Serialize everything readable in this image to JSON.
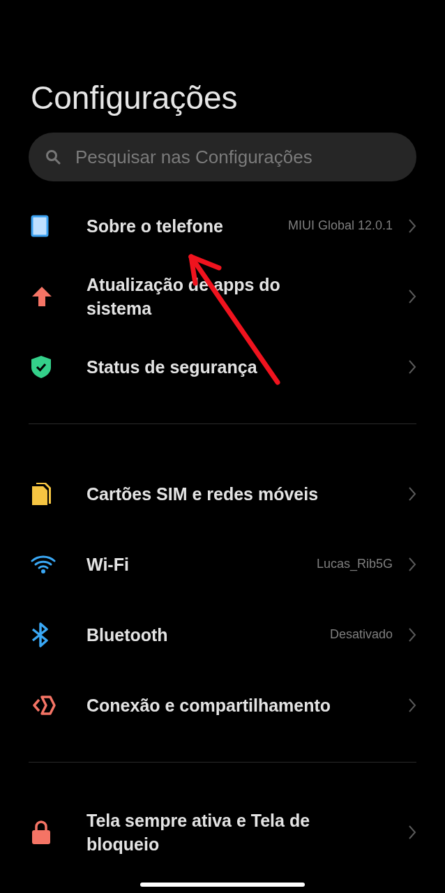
{
  "title": "Configurações",
  "search": {
    "placeholder": "Pesquisar nas Configurações"
  },
  "sections": [
    {
      "items": [
        {
          "kind": "phone",
          "label": "Sobre o telefone",
          "value": "MIUI Global 12.0.1"
        },
        {
          "kind": "update",
          "label": "Atualização de apps do sistema"
        },
        {
          "kind": "shield",
          "label": "Status de segurança"
        }
      ]
    },
    {
      "items": [
        {
          "kind": "sim",
          "label": "Cartões SIM e redes móveis"
        },
        {
          "kind": "wifi",
          "label": "Wi-Fi",
          "value": "Lucas_Rib5G"
        },
        {
          "kind": "bluetooth",
          "label": "Bluetooth",
          "value": "Desativado"
        },
        {
          "kind": "share",
          "label": "Conexão e compartilhamento"
        }
      ]
    },
    {
      "items": [
        {
          "kind": "lock",
          "label": "Tela sempre ativa e Tela de bloqueio"
        }
      ]
    }
  ]
}
